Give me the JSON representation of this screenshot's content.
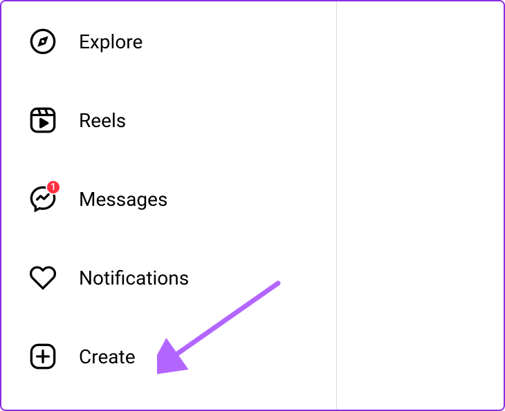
{
  "sidebar": {
    "items": [
      {
        "label": "Explore",
        "icon": "compass-icon",
        "name": "sidebar-item-explore"
      },
      {
        "label": "Reels",
        "icon": "reels-icon",
        "name": "sidebar-item-reels"
      },
      {
        "label": "Messages",
        "icon": "messenger-icon",
        "name": "sidebar-item-messages",
        "badge": "1"
      },
      {
        "label": "Notifications",
        "icon": "heart-icon",
        "name": "sidebar-item-notifications"
      },
      {
        "label": "Create",
        "icon": "plus-square-icon",
        "name": "sidebar-item-create"
      }
    ]
  },
  "annotation": {
    "arrow_color": "#b366ff",
    "target": "Create"
  }
}
